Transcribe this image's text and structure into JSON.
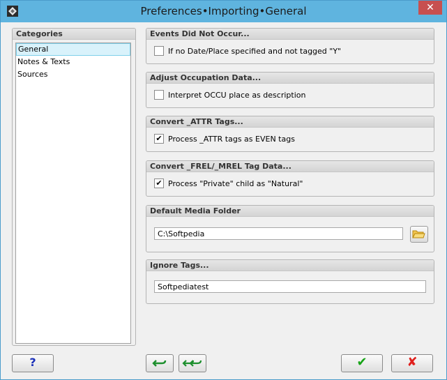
{
  "window": {
    "title": "Preferences•Importing•General",
    "close_glyph": "✕"
  },
  "categories": {
    "title": "Categories",
    "items": [
      "General",
      "Notes & Texts",
      "Sources"
    ]
  },
  "groups": {
    "events": {
      "title": "Events Did Not Occur...",
      "option": "If no Date/Place specified and not tagged \"Y\"",
      "checked": ""
    },
    "occupation": {
      "title": "Adjust Occupation Data...",
      "option": "Interpret OCCU place as description",
      "checked": ""
    },
    "attr": {
      "title": "Convert _ATTR Tags...",
      "option": "Process _ATTR tags as EVEN tags",
      "checked": "✔"
    },
    "frel": {
      "title": "Convert _FREL/_MREL Tag Data...",
      "option": "Process \"Private\" child as \"Natural\"",
      "checked": "✔"
    },
    "media": {
      "title": "Default Media Folder",
      "value": "C:\\Softpedia"
    },
    "ignore": {
      "title": "Ignore Tags...",
      "value": "Softpediatest"
    }
  },
  "buttons": {
    "help": "?",
    "ok": "✔",
    "cancel": "✘"
  },
  "colors": {
    "titlebar": "#5fb4df",
    "close": "#c75050",
    "ok_green": "#16a316",
    "cancel_red": "#e0201d",
    "help_blue": "#1a2fb8",
    "undo_green": "#1d8f2e"
  },
  "icons": [
    "app-icon",
    "close-icon",
    "folder-icon",
    "help-icon",
    "undo-icon",
    "undo-all-icon",
    "ok-check-icon",
    "cancel-x-icon"
  ]
}
